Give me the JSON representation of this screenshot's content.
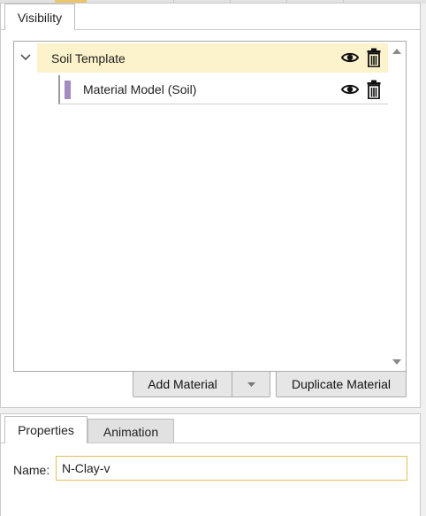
{
  "top_tabs": {
    "visibility": "Visibility"
  },
  "tree": {
    "parent": {
      "label": "Soil Template",
      "expanded": true,
      "icons": [
        "chevron-down-icon",
        "eye-icon",
        "trash-icon"
      ]
    },
    "child": {
      "label": "Material Model (Soil)",
      "color": "#a58cc0",
      "icons": [
        "eye-icon",
        "trash-icon"
      ]
    }
  },
  "buttons": {
    "add_material": "Add Material",
    "duplicate_material": "Duplicate Material"
  },
  "bottom_tabs": {
    "properties": "Properties",
    "animation": "Animation"
  },
  "properties": {
    "name_label": "Name:",
    "name_value": "N-Clay-v"
  },
  "colors": {
    "selected_row": "#fcf2cb",
    "input_focus_border": "#e3bf58"
  }
}
